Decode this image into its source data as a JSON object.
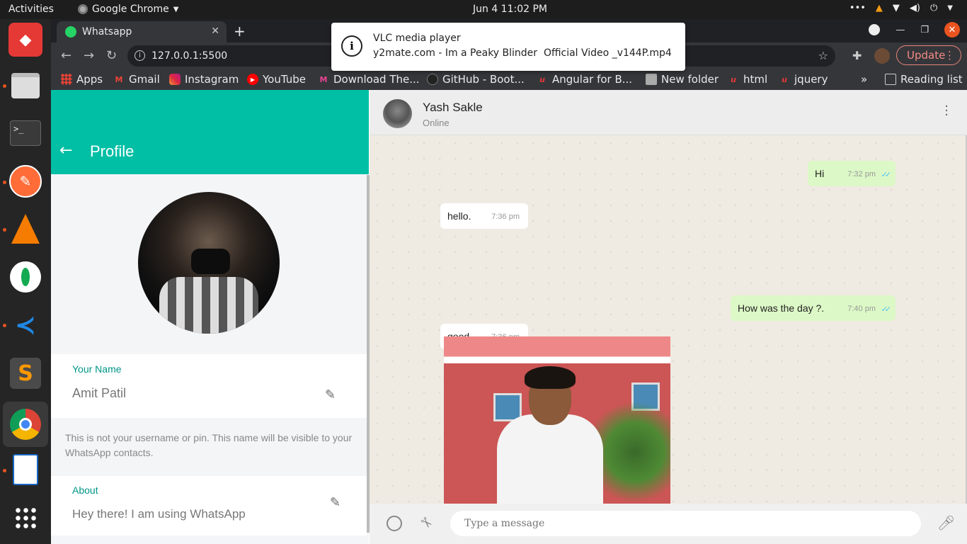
{
  "topbar": {
    "activities": "Activities",
    "app_name": "Google Chrome",
    "clock": "Jun 4  11:02 PM"
  },
  "browser": {
    "tab_title": "Whatsapp",
    "url": "127.0.0.1:5500",
    "update_label": "Update",
    "bookmarks": [
      {
        "label": "Apps",
        "icon": "apps-grid-icon"
      },
      {
        "label": "Gmail",
        "icon": "gmail-icon"
      },
      {
        "label": "Instagram",
        "icon": "instagram-icon"
      },
      {
        "label": "YouTube",
        "icon": "youtube-icon"
      },
      {
        "label": "Download The...",
        "icon": "download-site-icon"
      },
      {
        "label": "GitHub - Boot...",
        "icon": "github-icon"
      },
      {
        "label": "Angular for B...",
        "icon": "bookmark-site-icon"
      },
      {
        "label": "New folder",
        "icon": "folder-icon"
      },
      {
        "label": "html",
        "icon": "bookmark-site-icon"
      },
      {
        "label": "jquery",
        "icon": "bookmark-site-icon"
      }
    ],
    "more_bookmarks": "»",
    "reading_list": "Reading list"
  },
  "notification": {
    "app": "VLC media player",
    "message": "y2mate.com - Im a Peaky Blinder  Official Video _v144P.mp4"
  },
  "profile": {
    "title": "Profile",
    "name_label": "Your Name",
    "name_value": "Amit Patil",
    "name_note": "This is not your username or pin. This name will be visible to your WhatsApp contacts.",
    "about_label": "About",
    "about_value": "Hey there! I am using WhatsApp"
  },
  "chat": {
    "contact_name": "Yash Sakle",
    "contact_status": "Online",
    "messages": [
      {
        "text": "Hi",
        "time": "7:32 pm",
        "direction": "out"
      },
      {
        "text": "hello.",
        "time": "7:36 pm",
        "direction": "in"
      },
      {
        "text": "How was the day ?.",
        "time": "7:40 pm",
        "direction": "out"
      },
      {
        "text": "good.",
        "time": "7:36 pm",
        "direction": "in"
      }
    ],
    "composer_placeholder": "Type a message"
  },
  "colors": {
    "whatsapp_teal": "#00bfa5",
    "outgoing_bubble": "#dcf8c6",
    "accent_orange": "#e95420"
  }
}
